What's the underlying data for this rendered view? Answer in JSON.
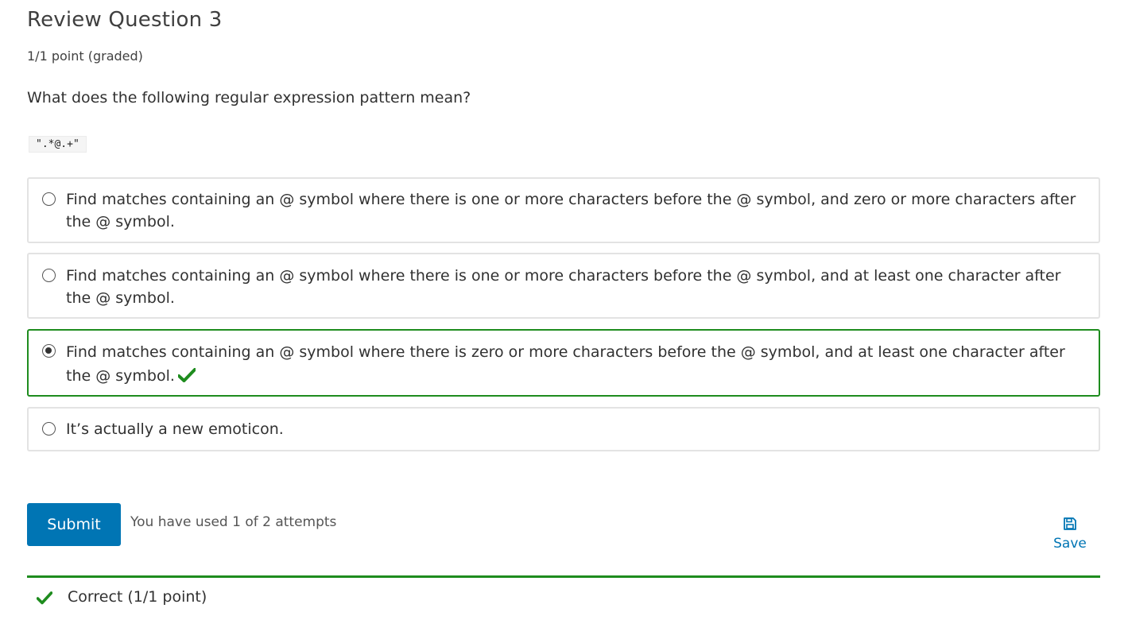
{
  "problem": {
    "title": "Review Question 3",
    "points": "1/1 point (graded)",
    "question": "What does the following regular expression pattern mean?",
    "code": "\".*@.+\""
  },
  "choices": [
    {
      "label": "Find matches containing an @ symbol where there is one or more characters before the @ symbol, and zero or more characters after the @ symbol.",
      "selected": false
    },
    {
      "label": "Find matches containing an @ symbol where there is one or more characters before the @ symbol, and at least one character after the @ symbol.",
      "selected": false
    },
    {
      "label": "Find matches containing an @ symbol where there is zero or more characters before the @ symbol, and at least one character after the @ symbol.",
      "selected": true,
      "correct": true
    },
    {
      "label": "It’s actually a new emoticon.",
      "selected": false
    }
  ],
  "actions": {
    "submit_label": "Submit",
    "attempts_text": "You have used 1 of 2 attempts",
    "save_label": "Save"
  },
  "result": {
    "text": "Correct (1/1 point)",
    "icon": "checkmark-icon"
  },
  "colors": {
    "accent": "#0075b4",
    "correct": "#1e8c1e"
  }
}
